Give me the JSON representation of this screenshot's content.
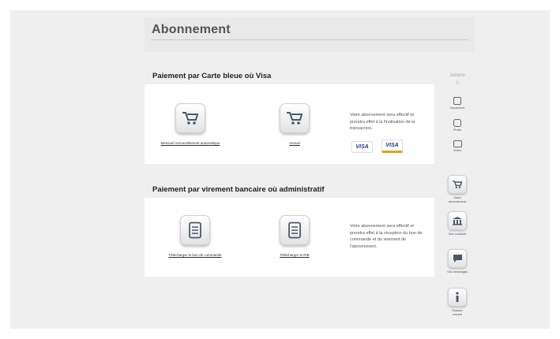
{
  "page": {
    "title": "Abonnement"
  },
  "card_section": {
    "title": "Paiement par Carte bleue où Visa",
    "options": [
      {
        "label": "Mensuel renouvellement automatique",
        "icon": "cart-icon"
      },
      {
        "label": "Annuel",
        "icon": "cart-icon"
      }
    ],
    "description": "Votre abonnement sera effectif et prendra effet à la finalisation de la transaction.",
    "cards": [
      "VISA",
      "VISA"
    ]
  },
  "transfer_section": {
    "title": "Paiement par virement bancaire où administratif",
    "options": [
      {
        "label": "Télécharger le bon de commande",
        "icon": "document-icon"
      },
      {
        "label": "Télécharger le RIB",
        "icon": "document-icon"
      }
    ],
    "description": "Votre abonnement sera effectif et prendra effet à la réception du bon de commande et du virement de l'abonnement."
  },
  "attach": {
    "title": "Joindre",
    "items": [
      {
        "label": "Document",
        "icon": "document-icon"
      },
      {
        "label": "Photo",
        "icon": "camera-icon"
      },
      {
        "label": "Vidéo",
        "icon": "video-icon"
      }
    ]
  },
  "sidenav": {
    "items": [
      {
        "label": "Votre abonnement",
        "icon": "cart-icon"
      },
      {
        "label": "Vos contacts",
        "icon": "bank-icon"
      },
      {
        "label": "Vos messages",
        "icon": "chat-icon"
      },
      {
        "label": "Espace conseil",
        "icon": "info-icon"
      }
    ]
  }
}
